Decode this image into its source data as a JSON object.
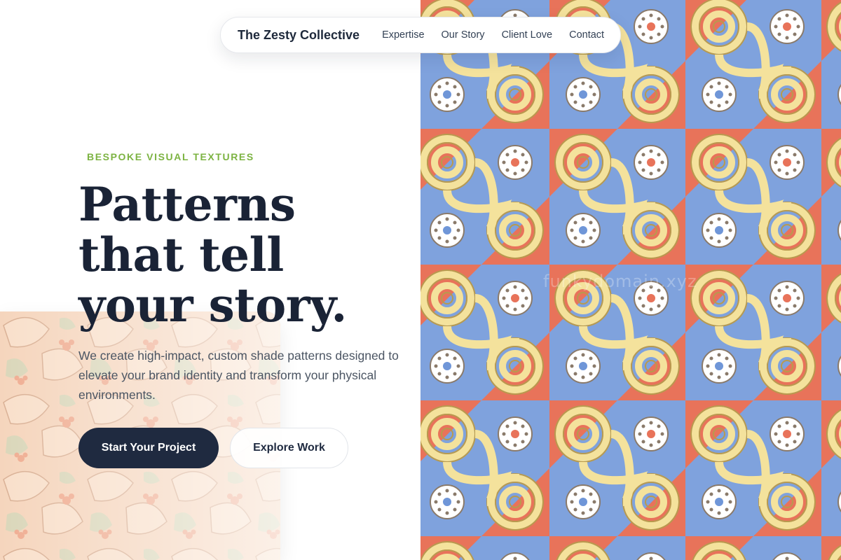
{
  "nav": {
    "brand": "The Zesty Collective",
    "links": [
      "Expertise",
      "Our Story",
      "Client Love",
      "Contact"
    ]
  },
  "hero": {
    "eyebrow": "BESPOKE VISUAL TEXTURES",
    "headline": "Patterns that tell your story.",
    "subtext": "We create high-impact, custom shade patterns designed to elevate your brand identity and transform your physical environments.",
    "primary_cta": "Start Your Project",
    "secondary_cta": "Explore Work"
  },
  "pattern_panel": {
    "watermark": "funkydomain.xyz"
  },
  "colors": {
    "accent_green": "#7cb342",
    "navy": "#1f2a40",
    "pattern_blue": "#7fa2dd",
    "pattern_red": "#e8735a",
    "pattern_yellow": "#f4e29c"
  }
}
